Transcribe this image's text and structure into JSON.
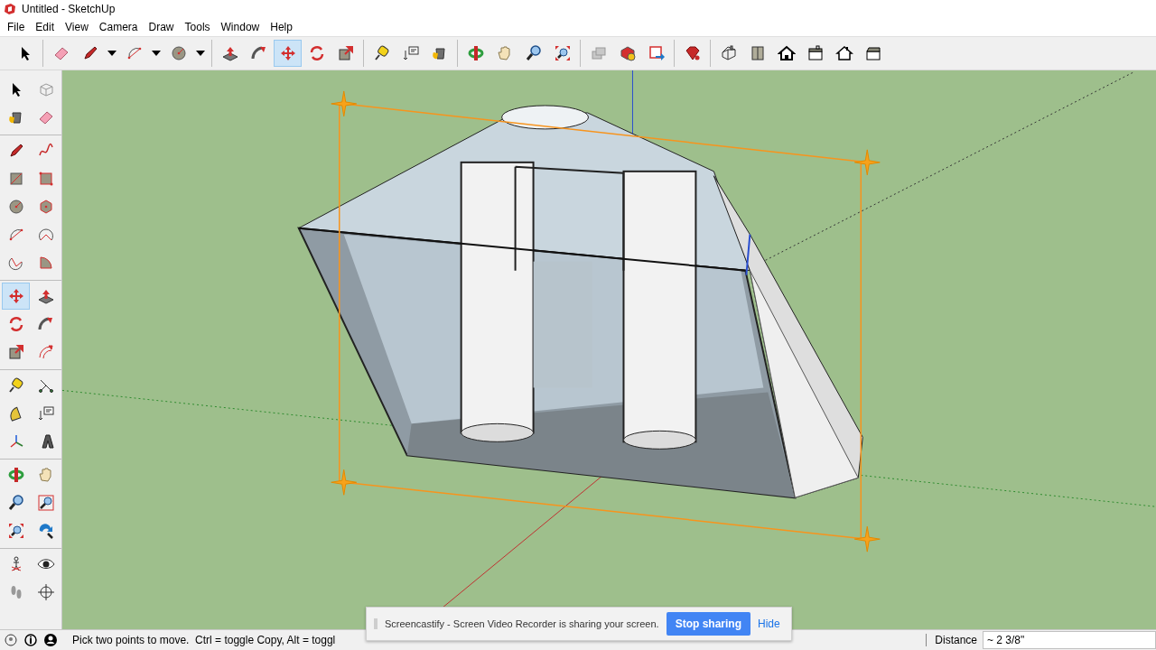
{
  "window": {
    "title": "Untitled - SketchUp"
  },
  "menu": [
    "File",
    "Edit",
    "View",
    "Camera",
    "Draw",
    "Tools",
    "Window",
    "Help"
  ],
  "toolbar": {
    "groups": [
      [
        {
          "kind": "select",
          "selected": false
        }
      ],
      [
        {
          "kind": "eraser",
          "selected": false
        },
        {
          "kind": "pencil",
          "selected": false
        },
        {
          "kind": "caret",
          "selected": false
        },
        {
          "kind": "arc",
          "selected": false
        },
        {
          "kind": "caret",
          "selected": false
        },
        {
          "kind": "circle",
          "selected": false
        },
        {
          "kind": "caret",
          "selected": false
        }
      ],
      [
        {
          "kind": "pushpull",
          "selected": false
        },
        {
          "kind": "followme",
          "selected": false
        },
        {
          "kind": "move",
          "selected": true
        },
        {
          "kind": "rotate",
          "selected": false
        },
        {
          "kind": "scale",
          "selected": false
        }
      ],
      [
        {
          "kind": "tape",
          "selected": false
        },
        {
          "kind": "text",
          "selected": false
        },
        {
          "kind": "paint",
          "selected": false
        }
      ],
      [
        {
          "kind": "orbit",
          "selected": false
        },
        {
          "kind": "pan",
          "selected": false
        },
        {
          "kind": "zoom",
          "selected": false
        },
        {
          "kind": "zoomextents",
          "selected": false
        }
      ],
      [
        {
          "kind": "styles",
          "selected": false
        },
        {
          "kind": "components",
          "selected": false
        },
        {
          "kind": "upload",
          "selected": false
        }
      ],
      [
        {
          "kind": "gem",
          "selected": false
        }
      ],
      [
        {
          "kind": "iso",
          "selected": false
        },
        {
          "kind": "topview",
          "selected": false
        },
        {
          "kind": "front",
          "selected": false
        },
        {
          "kind": "right",
          "selected": false
        },
        {
          "kind": "back",
          "selected": false
        },
        {
          "kind": "left",
          "selected": false
        }
      ]
    ]
  },
  "left_toolbar": {
    "groups": [
      [
        {
          "kind": "select",
          "selected": false
        },
        {
          "kind": "component",
          "selected": false
        },
        {
          "kind": "paint",
          "selected": false
        },
        {
          "kind": "eraser",
          "selected": false
        }
      ],
      [
        {
          "kind": "pencil",
          "selected": false
        },
        {
          "kind": "freehand",
          "selected": false
        },
        {
          "kind": "rectangle",
          "selected": false
        },
        {
          "kind": "rotrect",
          "selected": false
        },
        {
          "kind": "circle",
          "selected": false
        },
        {
          "kind": "polygon",
          "selected": false
        },
        {
          "kind": "arc",
          "selected": false
        },
        {
          "kind": "arc3",
          "selected": false
        },
        {
          "kind": "arc2",
          "selected": false
        },
        {
          "kind": "pie",
          "selected": false
        }
      ],
      [
        {
          "kind": "move",
          "selected": true
        },
        {
          "kind": "pushpull",
          "selected": false
        },
        {
          "kind": "rotate",
          "selected": false
        },
        {
          "kind": "followme",
          "selected": false
        },
        {
          "kind": "scale",
          "selected": false
        },
        {
          "kind": "offset",
          "selected": false
        }
      ],
      [
        {
          "kind": "tape",
          "selected": false
        },
        {
          "kind": "dimension",
          "selected": false
        },
        {
          "kind": "protractor",
          "selected": false
        },
        {
          "kind": "text",
          "selected": false
        },
        {
          "kind": "axes",
          "selected": false
        },
        {
          "kind": "text3d",
          "selected": false
        }
      ],
      [
        {
          "kind": "orbit",
          "selected": false
        },
        {
          "kind": "pan",
          "selected": false
        },
        {
          "kind": "zoom",
          "selected": false
        },
        {
          "kind": "zoomwindow",
          "selected": false
        },
        {
          "kind": "zoomextents",
          "selected": false
        },
        {
          "kind": "previous",
          "selected": false
        }
      ],
      [
        {
          "kind": "position",
          "selected": false
        },
        {
          "kind": "look",
          "selected": false
        },
        {
          "kind": "walk",
          "selected": false
        },
        {
          "kind": "section",
          "selected": false
        }
      ]
    ]
  },
  "status_bar": {
    "hint": "Pick two points to move.  Ctrl = toggle Copy, Alt = toggl",
    "measurement_label": "Distance",
    "measurement_value": "~ 2 3/8\""
  },
  "notification": {
    "text": "Screencastify - Screen Video Recorder is sharing your screen.",
    "buttons": [
      "Stop sharing",
      "Hide"
    ]
  }
}
